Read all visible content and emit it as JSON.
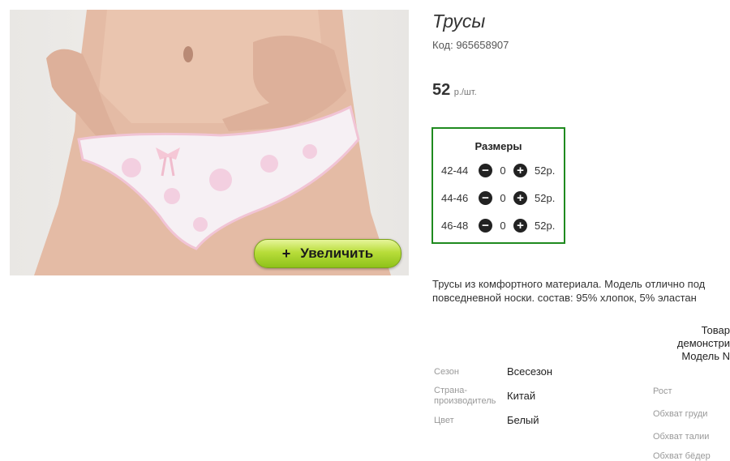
{
  "product": {
    "title": "Трусы",
    "code": "Код: 965658907",
    "price": "52",
    "price_unit": "р./шт."
  },
  "photo": {
    "zoom_label": "Увеличить",
    "zoom_plus": "+"
  },
  "sizes": {
    "title": "Размеры",
    "rows": [
      {
        "size": "42-44",
        "qty": "0",
        "price": "52р."
      },
      {
        "size": "44-46",
        "qty": "0",
        "price": "52р."
      },
      {
        "size": "46-48",
        "qty": "0",
        "price": "52р."
      }
    ],
    "minus_icon": "minus-circle-icon",
    "plus_icon": "plus-circle-icon"
  },
  "description": {
    "line1": "Трусы из комфортного материала. Модель отлично под",
    "line2": "повседневной носки. состав: 95% хлопок, 5% эластан"
  },
  "model_info": {
    "line1": "Товар",
    "line2": "демонстри",
    "line3": "Модель N"
  },
  "properties": [
    {
      "label": "Сезон",
      "value": "Всесезон"
    },
    {
      "label": "Страна-производитель",
      "value": "Китай"
    },
    {
      "label": "Цвет",
      "value": "Белый"
    }
  ],
  "measurements": [
    "Рост",
    "Обхват груди",
    "Обхват талии",
    "Обхват бёдер"
  ],
  "colors": {
    "sizes_border": "#1f8a1f",
    "zoom_button": "#b8dd3a"
  }
}
